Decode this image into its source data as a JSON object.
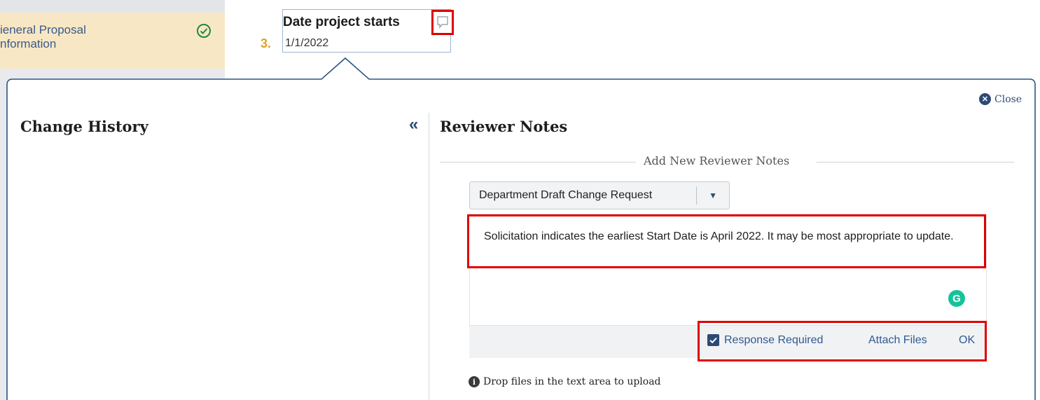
{
  "sidebar": {
    "active_item": "General Proposal\nInformation",
    "active_item_display": "ieneral Proposal\nnformation"
  },
  "field": {
    "step_number": "3.",
    "title": "Date project starts",
    "value": "1/1/2022"
  },
  "panel": {
    "close_label": "Close",
    "change_history_title": "Change History",
    "reviewer_notes_title": "Reviewer Notes",
    "add_section_heading": "Add New Reviewer Notes",
    "note_type_selected": "Department Draft Change Request",
    "note_text": "Solicitation indicates the earliest Start Date is April 2022. It may be most appropriate to update.",
    "response_required_label": "Response Required",
    "response_required_checked": true,
    "attach_files_label": "Attach Files",
    "ok_label": "OK",
    "drop_hint": "Drop files in the text area to upload"
  },
  "colors": {
    "accent_blue": "#2d4a73",
    "highlight_red": "#e00000",
    "active_item_bg": "#f8e7c4",
    "step_number_orange": "#e0a127",
    "grammarly_green": "#15c39a"
  }
}
